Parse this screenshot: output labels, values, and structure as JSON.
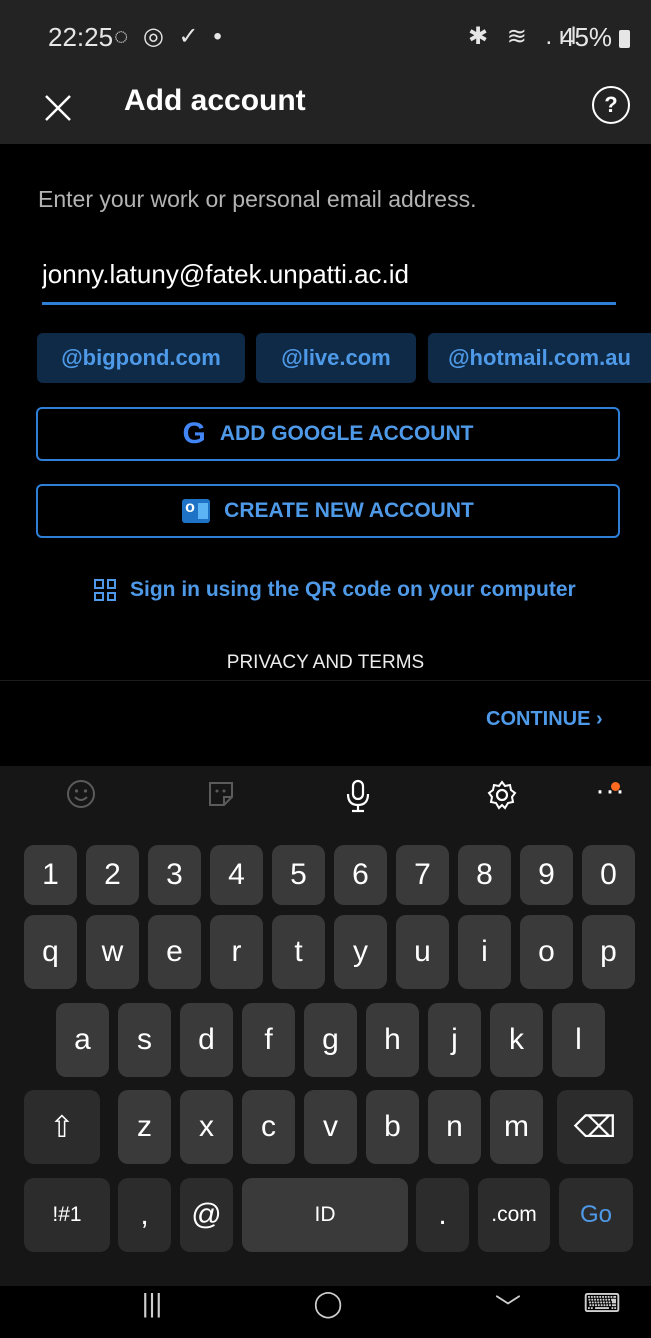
{
  "status_bar": {
    "time": "22:25",
    "left_icons": "◌ ◎ ✓ •",
    "right_icons": "✱ ≋ .ıl",
    "battery": "45%"
  },
  "header": {
    "title": "Add account",
    "help_label": "?"
  },
  "form": {
    "prompt": "Enter your work or personal email address.",
    "email_value": "jonny.latuny@fatek.unpatti.ac.id",
    "domain_suggestions": [
      "@bigpond.com",
      "@live.com",
      "@hotmail.com.au"
    ],
    "google_button": "ADD GOOGLE ACCOUNT",
    "create_button": "CREATE NEW ACCOUNT",
    "qr_link": "Sign in using the QR code on your computer",
    "privacy_link": "PRIVACY AND TERMS",
    "continue_button": "CONTINUE ›"
  },
  "keyboard": {
    "toolbar": [
      "emoji-icon",
      "sticker-icon",
      "microphone-icon",
      "gear-icon",
      "more-icon"
    ],
    "row_numbers": [
      "1",
      "2",
      "3",
      "4",
      "5",
      "6",
      "7",
      "8",
      "9",
      "0"
    ],
    "row_1": [
      "q",
      "w",
      "e",
      "r",
      "t",
      "y",
      "u",
      "i",
      "o",
      "p"
    ],
    "row_2": [
      "a",
      "s",
      "d",
      "f",
      "g",
      "h",
      "j",
      "k",
      "l"
    ],
    "row_3": [
      "z",
      "x",
      "c",
      "v",
      "b",
      "n",
      "m"
    ],
    "shift_key": "⇧",
    "backspace_key": "⌫",
    "symbols_key": "!#1",
    "comma_key": ",",
    "at_key": "@",
    "space_label": "ID",
    "period_key": ".",
    "dotcom_key": ".com",
    "go_key": "Go"
  },
  "nav_bar": {
    "recents": "|||",
    "home": "◯",
    "back": "﹀",
    "keyboard_toggle": "⌨"
  },
  "colors": {
    "accent": "#2f7fd9",
    "accent_text": "#4f9ae8",
    "chip_bg": "#0e2a47",
    "app_bar": "#232323",
    "key_bg": "#3a3a3a",
    "notification_dot": "#ff6a21"
  }
}
